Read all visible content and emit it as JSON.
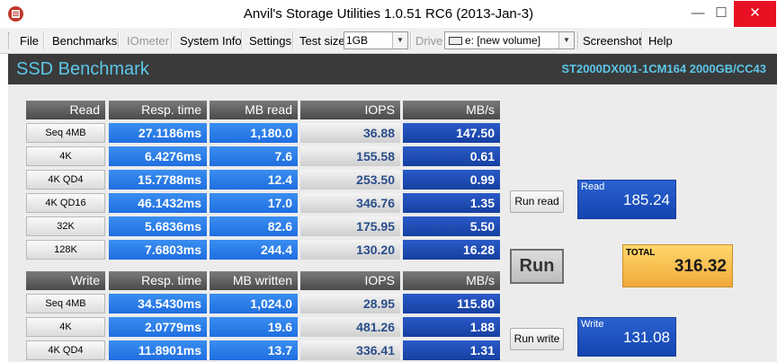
{
  "window": {
    "title": "Anvil's Storage Utilities 1.0.51 RC6 (2013-Jan-3)",
    "minimize_glyph": "—",
    "maximize_glyph": "☐",
    "close_glyph": "✕"
  },
  "menu": {
    "file": "File",
    "benchmarks": "Benchmarks",
    "iometer": "IOmeter",
    "system_info": "System Info",
    "settings": "Settings",
    "test_size_label": "Test size",
    "test_size_value": "1GB",
    "drive_label": "Drive",
    "drive_value": "e: [new volume]",
    "screenshot": "Screenshot",
    "help": "Help"
  },
  "banner": {
    "title": "SSD Benchmark",
    "model": "ST2000DX001-1CM164 2000GB/CC43"
  },
  "read": {
    "headers": [
      "Read",
      "Resp. time",
      "MB read",
      "IOPS",
      "MB/s"
    ],
    "rows": [
      {
        "label": "Seq 4MB",
        "resp": "27.1186ms",
        "mb": "1,180.0",
        "iops": "36.88",
        "mbs": "147.50"
      },
      {
        "label": "4K",
        "resp": "6.4276ms",
        "mb": "7.6",
        "iops": "155.58",
        "mbs": "0.61"
      },
      {
        "label": "4K QD4",
        "resp": "15.7788ms",
        "mb": "12.4",
        "iops": "253.50",
        "mbs": "0.99"
      },
      {
        "label": "4K QD16",
        "resp": "46.1432ms",
        "mb": "17.0",
        "iops": "346.76",
        "mbs": "1.35"
      },
      {
        "label": "32K",
        "resp": "5.6836ms",
        "mb": "82.6",
        "iops": "175.95",
        "mbs": "5.50"
      },
      {
        "label": "128K",
        "resp": "7.6803ms",
        "mb": "244.4",
        "iops": "130.20",
        "mbs": "16.28"
      }
    ]
  },
  "write": {
    "headers": [
      "Write",
      "Resp. time",
      "MB written",
      "IOPS",
      "MB/s"
    ],
    "rows": [
      {
        "label": "Seq 4MB",
        "resp": "34.5430ms",
        "mb": "1,024.0",
        "iops": "28.95",
        "mbs": "115.80"
      },
      {
        "label": "4K",
        "resp": "2.0779ms",
        "mb": "19.6",
        "iops": "481.26",
        "mbs": "1.88"
      },
      {
        "label": "4K QD4",
        "resp": "11.8901ms",
        "mb": "13.7",
        "iops": "336.41",
        "mbs": "1.31"
      }
    ]
  },
  "buttons": {
    "run_read": "Run read",
    "run": "Run",
    "run_write": "Run write"
  },
  "scores": {
    "read_label": "Read",
    "read_value": "185.24",
    "total_label": "TOTAL",
    "total_value": "316.32",
    "write_label": "Write",
    "write_value": "131.08"
  },
  "colors": {
    "banner_text": "#5cc6e8",
    "result_blue": "#1f6ee0",
    "mbs_blue": "#1640a0",
    "total_orange": "#f2a83a",
    "close_red": "#e81123"
  }
}
